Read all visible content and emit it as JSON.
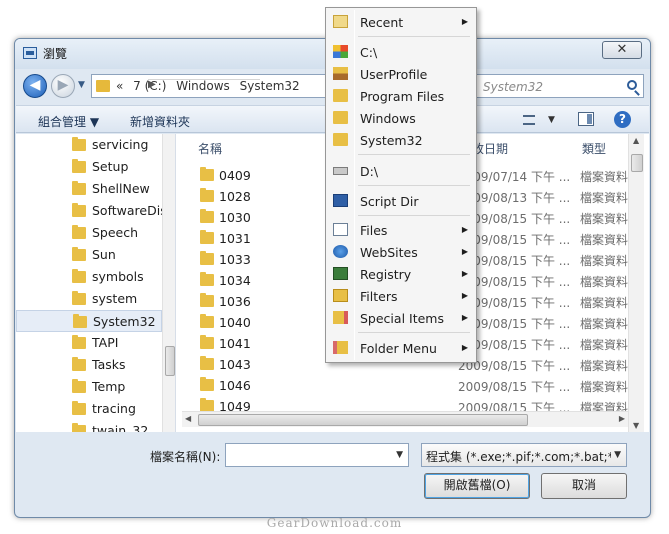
{
  "window": {
    "title": "瀏覽",
    "close_glyph": "✕"
  },
  "nav": {
    "back_glyph": "◀",
    "forward_glyph": "▶",
    "history_glyph": "▼",
    "address_crumbs": [
      "«",
      "7 (C:)",
      "Windows",
      "System32"
    ],
    "crumb_separator": "▶",
    "search_placeholder": "System32"
  },
  "commandbar": {
    "organize_label": "組合管理 ▼",
    "new_folder_label": "新增資料夾",
    "view_arrow": "▼",
    "help_glyph": "?"
  },
  "navpane": {
    "items": [
      {
        "label": "servicing"
      },
      {
        "label": "Setup"
      },
      {
        "label": "ShellNew"
      },
      {
        "label": "SoftwareDist"
      },
      {
        "label": "Speech"
      },
      {
        "label": "Sun"
      },
      {
        "label": "symbols"
      },
      {
        "label": "system"
      },
      {
        "label": "System32"
      },
      {
        "label": "TAPI"
      },
      {
        "label": "Tasks"
      },
      {
        "label": "Temp"
      },
      {
        "label": "tracing"
      },
      {
        "label": "twain_32"
      }
    ],
    "selected": "System32"
  },
  "filelist": {
    "columns": {
      "name": "名稱",
      "date": "修改日期",
      "type": "類型"
    },
    "rows": [
      {
        "name": "0409",
        "date": "2009/07/14 下午 ...",
        "type": "檔案資料..."
      },
      {
        "name": "1028",
        "date": "2009/08/13 下午 ...",
        "type": "檔案資料..."
      },
      {
        "name": "1030",
        "date": "2009/08/15 下午 ...",
        "type": "檔案資料..."
      },
      {
        "name": "1031",
        "date": "2009/08/15 下午 ...",
        "type": "檔案資料..."
      },
      {
        "name": "1033",
        "date": "2009/08/15 下午 ...",
        "type": "檔案資料..."
      },
      {
        "name": "1034",
        "date": "2009/08/15 下午 ...",
        "type": "檔案資料..."
      },
      {
        "name": "1036",
        "date": "2009/08/15 下午 ...",
        "type": "檔案資料..."
      },
      {
        "name": "1040",
        "date": "2009/08/15 下午 ...",
        "type": "檔案資料..."
      },
      {
        "name": "1041",
        "date": "2009/08/15 下午 ...",
        "type": "檔案資料..."
      },
      {
        "name": "1043",
        "date": "2009/08/15 下午 ...",
        "type": "檔案資料..."
      },
      {
        "name": "1046",
        "date": "2009/08/15 下午 ...",
        "type": "檔案資料..."
      },
      {
        "name": "1049",
        "date": "2009/08/15 下午 ...",
        "type": "檔案資料..."
      }
    ],
    "hscroll_grip": "|||"
  },
  "footer": {
    "filename_label": "檔案名稱(N):",
    "filename_value": "",
    "filter_value": "程式集 (*.exe;*.pif;*.com;*.bat;*.cmd)",
    "open_label": "開啟舊檔(O)",
    "cancel_label": "取消",
    "dropdown_glyph": "▼"
  },
  "menu": {
    "items": [
      {
        "label": "Recent",
        "icon": "recent-icon",
        "submenu": true
      },
      {
        "label": "C:\\",
        "icon": "drive-c-icon",
        "submenu": false
      },
      {
        "label": "UserProfile",
        "icon": "user-folder-icon",
        "submenu": false
      },
      {
        "label": "Program Files",
        "icon": "folder-icon",
        "submenu": false
      },
      {
        "label": "Windows",
        "icon": "folder-icon",
        "submenu": false
      },
      {
        "label": "System32",
        "icon": "folder-icon",
        "submenu": false
      },
      {
        "label": "D:\\",
        "icon": "drive-icon",
        "submenu": false
      },
      {
        "label": "Script Dir",
        "icon": "script-icon",
        "submenu": false
      },
      {
        "label": "Files",
        "icon": "files-icon",
        "submenu": true
      },
      {
        "label": "WebSites",
        "icon": "web-icon",
        "submenu": true
      },
      {
        "label": "Registry",
        "icon": "registry-icon",
        "submenu": true
      },
      {
        "label": "Filters",
        "icon": "filter-icon",
        "submenu": true
      },
      {
        "label": "Special Items",
        "icon": "special-icon",
        "submenu": true
      },
      {
        "label": "Folder Menu",
        "icon": "folder-menu-icon",
        "submenu": true
      }
    ],
    "arrow_glyph": "▶"
  },
  "watermark": "GearDownload.com"
}
